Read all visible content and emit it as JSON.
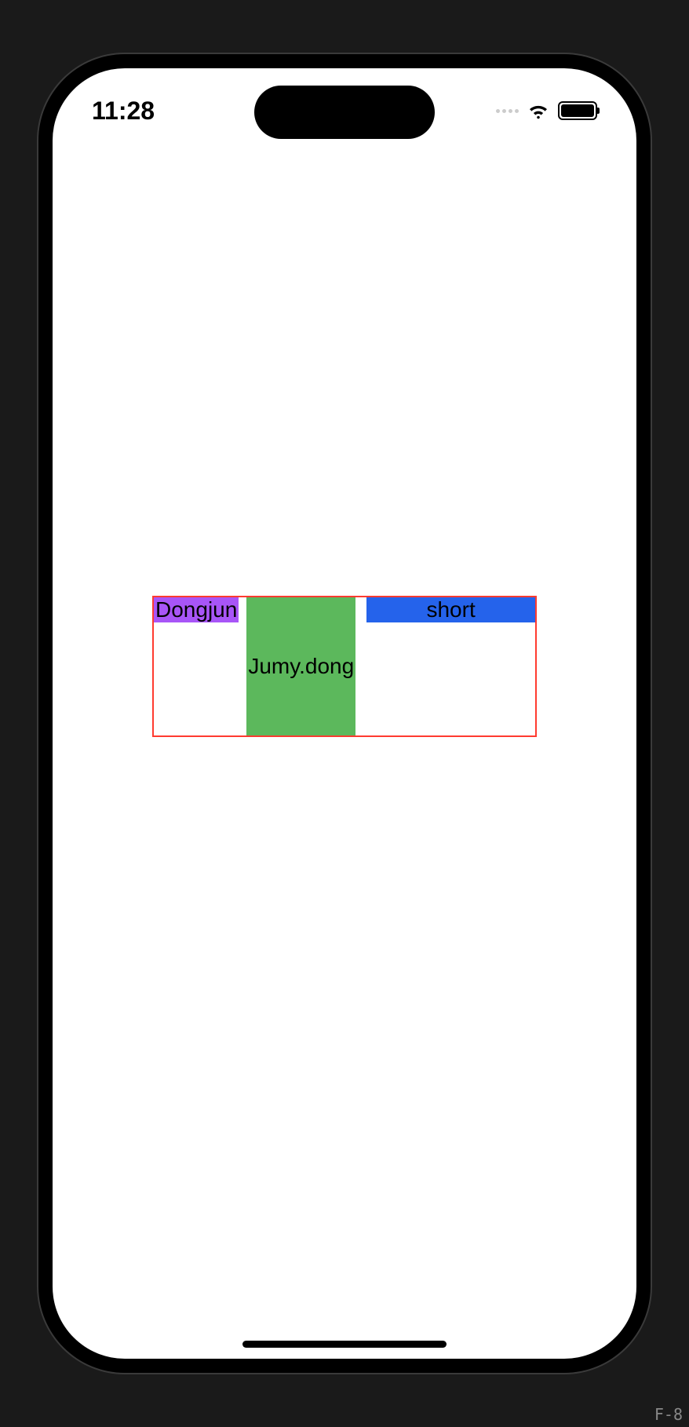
{
  "status_bar": {
    "time": "11:28"
  },
  "demo": {
    "left_label": "Dongjun",
    "center_label": "Jumy.dong",
    "right_label": "short"
  },
  "corner_label": "F-8",
  "colors": {
    "purple": "#a855f7",
    "green": "#5cb85c",
    "blue": "#2563eb",
    "red_border": "#ff3b30"
  }
}
